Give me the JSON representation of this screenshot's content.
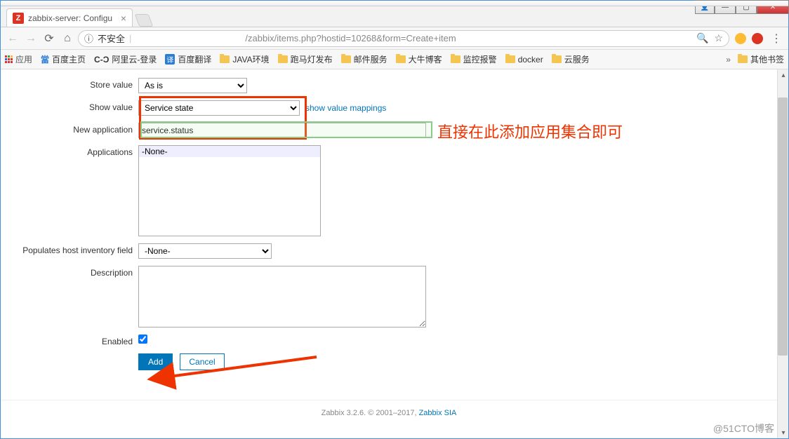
{
  "window": {
    "tab_title": "zabbix-server: Configu",
    "favicon_letter": "Z"
  },
  "navbar": {
    "insecure_label": "不安全",
    "url_path": "/zabbix/items.php?hostid=10268&form=Create+item"
  },
  "bookmarks": {
    "apps": "应用",
    "items": [
      "百度主页",
      "阿里云-登录",
      "百度翻译",
      "JAVA环境",
      "跑马灯发布",
      "邮件服务",
      "大牛博客",
      "监控报警",
      "docker",
      "云服务"
    ],
    "other": "其他书签"
  },
  "form": {
    "store_value_label": "Store value",
    "store_value": "As is",
    "show_value_label": "Show value",
    "show_value": "Service state",
    "show_value_link": "show value mappings",
    "new_app_label": "New application",
    "new_app_value": "service.status",
    "applications_label": "Applications",
    "applications_none": "-None-",
    "inventory_label": "Populates host inventory field",
    "inventory_value": "-None-",
    "description_label": "Description",
    "enabled_label": "Enabled",
    "add_btn": "Add",
    "cancel_btn": "Cancel"
  },
  "annotation": "直接在此添加应用集合即可",
  "footer": {
    "text": "Zabbix 3.2.6. © 2001–2017, ",
    "link": "Zabbix SIA"
  },
  "watermark": "@51CTO博客"
}
